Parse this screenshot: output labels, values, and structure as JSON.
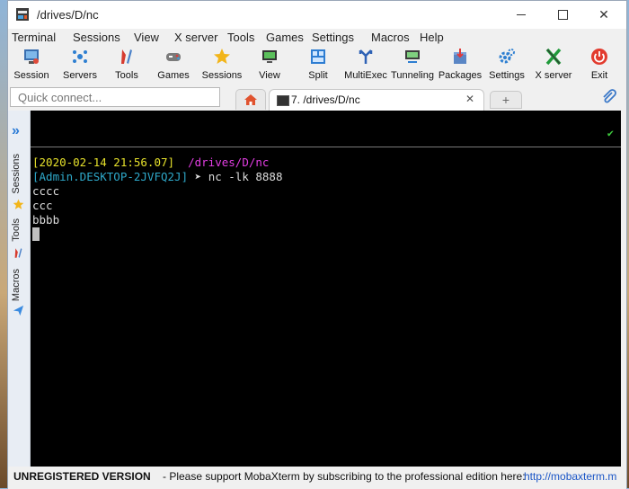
{
  "window": {
    "title": "/drives/D/nc"
  },
  "menu": [
    "Terminal",
    "Sessions",
    "View",
    "X server",
    "Tools",
    "Games",
    "Settings",
    "Macros",
    "Help"
  ],
  "toolbar": {
    "session": "Session",
    "servers": "Servers",
    "tools": "Tools",
    "games": "Games",
    "sessions": "Sessions",
    "view": "View",
    "split": "Split",
    "multiexec": "MultiExec",
    "tunneling": "Tunneling",
    "packages": "Packages",
    "settings": "Settings",
    "xserver": "X server",
    "exit": "Exit"
  },
  "quick_connect": {
    "placeholder": "Quick connect..."
  },
  "tabs": {
    "active_label": "7. /drives/D/nc",
    "close": "✕",
    "new": "+"
  },
  "sidebar": {
    "sessions": "Sessions",
    "tools": "Tools",
    "macros": "Macros"
  },
  "terminal": {
    "prompt_time": "[2020-02-14 21:56.07]",
    "prompt_path": "/drives/D/nc",
    "prompt_user": "[Admin.DESKTOP-2JVFQ2J]",
    "prompt_arrow": "➤",
    "command": "nc -lk 8888",
    "output": [
      "cccc",
      "ccc",
      "bbbb"
    ],
    "check": "✔"
  },
  "status": {
    "unregistered": "UNREGISTERED VERSION",
    "message": "-  Please support MobaXterm by subscribing to the professional edition here:",
    "link": "http://mobaxterm.m"
  },
  "colors": {
    "prompt_time": "#e6e12b",
    "prompt_path": "#e23de2",
    "prompt_user": "#2ea8c9",
    "link": "#1a55c6"
  }
}
